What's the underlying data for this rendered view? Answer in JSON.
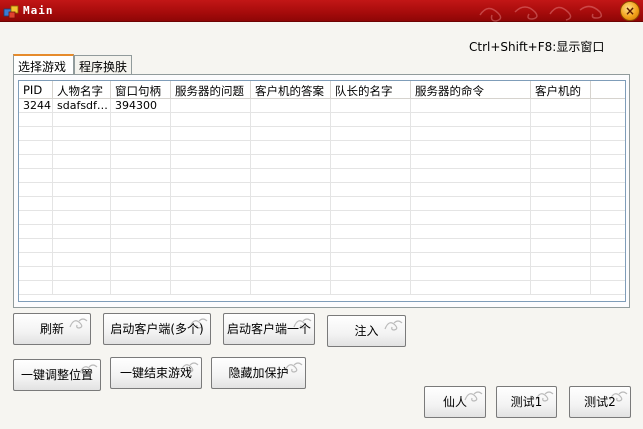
{
  "window": {
    "title": "Main",
    "close_label": "×"
  },
  "hotkey_hint": "Ctrl+Shift+F8:显示窗口",
  "tabs": [
    {
      "label": "选择游戏",
      "active": true
    },
    {
      "label": "程序换肤",
      "active": false
    }
  ],
  "table": {
    "columns": [
      "PID",
      "人物名字",
      "窗口句柄",
      "服务器的问题",
      "客户机的答案",
      "队长的名字",
      "服务器的命令",
      "客户机的",
      ""
    ],
    "rows": [
      [
        "3244",
        "sdafsdf…",
        "394300",
        "",
        "",
        "",
        "",
        "",
        ""
      ]
    ]
  },
  "buttons": {
    "refresh": "刷新",
    "start_clients_multi": "启动客户端(多个)",
    "start_client_one": "启动客户端一个",
    "inject": "注入",
    "adjust_position": "一键调整位置",
    "end_games": "一键结束游戏",
    "hide_protect": "隐藏加保护",
    "xianren": "仙人",
    "test1": "测试1",
    "test2": "测试2"
  },
  "colors": {
    "titlebar": "#b01010",
    "tab_accent": "#e68b2c",
    "grid_border": "#7f9db9"
  }
}
